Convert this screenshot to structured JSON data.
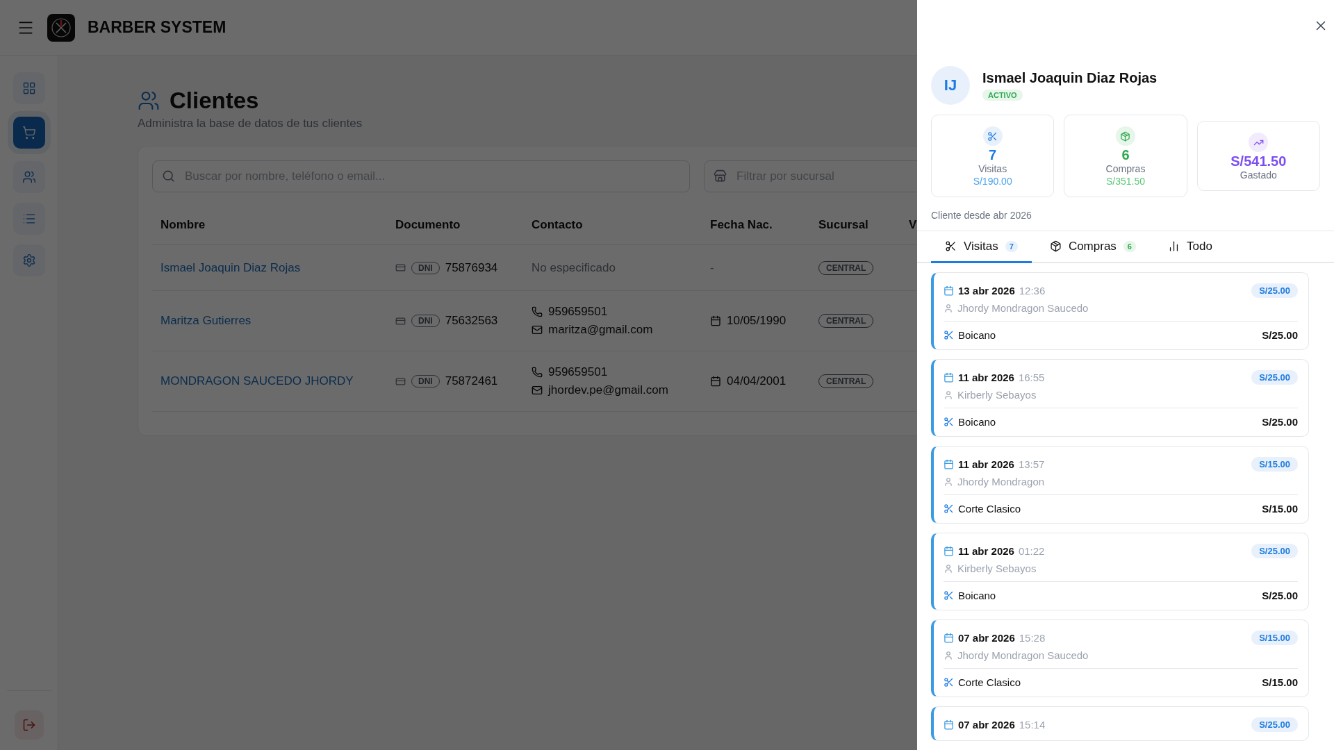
{
  "header": {
    "title": "BARBER SYSTEM"
  },
  "sidebar": {
    "items": [
      {
        "kind": "dashboard",
        "selected": false
      },
      {
        "kind": "sales",
        "selected": true
      },
      {
        "kind": "clients",
        "selected": false
      },
      {
        "kind": "list",
        "selected": false
      },
      {
        "kind": "settings",
        "selected": false
      }
    ]
  },
  "page": {
    "title": "Clientes",
    "subtitle": "Administra la base de datos de tus clientes"
  },
  "search": {
    "placeholder": "Buscar por nombre, teléfono o email..."
  },
  "branch_filter": {
    "placeholder": "Filtrar por sucursal"
  },
  "table": {
    "columns": [
      "Nombre",
      "Documento",
      "Contacto",
      "Fecha Nac.",
      "Sucursal",
      "V"
    ],
    "rows": [
      {
        "name": "Ismael Joaquin Diaz Rojas",
        "doc_type": "DNI",
        "doc_number": "75876934",
        "contact_missing": "No especificado",
        "birth_date": "-",
        "branch": "CENTRAL"
      },
      {
        "name": "Maritza Gutierres",
        "doc_type": "DNI",
        "doc_number": "75632563",
        "phone": "959659501",
        "email": "maritza@gmail.com",
        "birth_date": "10/05/1990",
        "branch": "CENTRAL"
      },
      {
        "name": "MONDRAGON SAUCEDO JHORDY",
        "doc_type": "DNI",
        "doc_number": "75872461",
        "phone": "959659501",
        "email": "jhordev.pe@gmail.com",
        "birth_date": "04/04/2001",
        "branch": "CENTRAL"
      }
    ]
  },
  "drawer": {
    "initials": "IJ",
    "name": "Ismael Joaquin Diaz Rojas",
    "status": "ACTIVO",
    "stats": [
      {
        "kind": "visits",
        "value": "7",
        "label": "Visitas",
        "amount": "S/190.00"
      },
      {
        "kind": "purchases",
        "value": "6",
        "label": "Compras",
        "amount": "S/351.50"
      },
      {
        "kind": "spent",
        "value": "S/541.50",
        "label": "Gastado"
      }
    ],
    "since": "Cliente desde abr 2026",
    "tabs": [
      {
        "kind": "visits",
        "label": "Visitas",
        "count": "7",
        "selected": true
      },
      {
        "kind": "purchases",
        "label": "Compras",
        "count": "6",
        "selected": false
      },
      {
        "kind": "all",
        "label": "Todo",
        "selected": false
      }
    ],
    "visits": [
      {
        "date": "13 abr 2026",
        "time": "12:36",
        "badge": "S/25.00",
        "barber": "Jhordy Mondragon Saucedo",
        "service": "Boicano",
        "price": "S/25.00"
      },
      {
        "date": "11 abr 2026",
        "time": "16:55",
        "badge": "S/25.00",
        "barber": "Kirberly Sebayos",
        "service": "Boicano",
        "price": "S/25.00"
      },
      {
        "date": "11 abr 2026",
        "time": "13:57",
        "badge": "S/15.00",
        "barber": "Jhordy Mondragon",
        "service": "Corte Clasico",
        "price": "S/15.00"
      },
      {
        "date": "11 abr 2026",
        "time": "01:22",
        "badge": "S/25.00",
        "barber": "Kirberly Sebayos",
        "service": "Boicano",
        "price": "S/25.00"
      },
      {
        "date": "07 abr 2026",
        "time": "15:28",
        "badge": "S/15.00",
        "barber": "Jhordy Mondragon Saucedo",
        "service": "Corte Clasico",
        "price": "S/15.00"
      },
      {
        "date": "07 abr 2026",
        "time": "15:14",
        "badge": "S/25.00"
      }
    ]
  }
}
